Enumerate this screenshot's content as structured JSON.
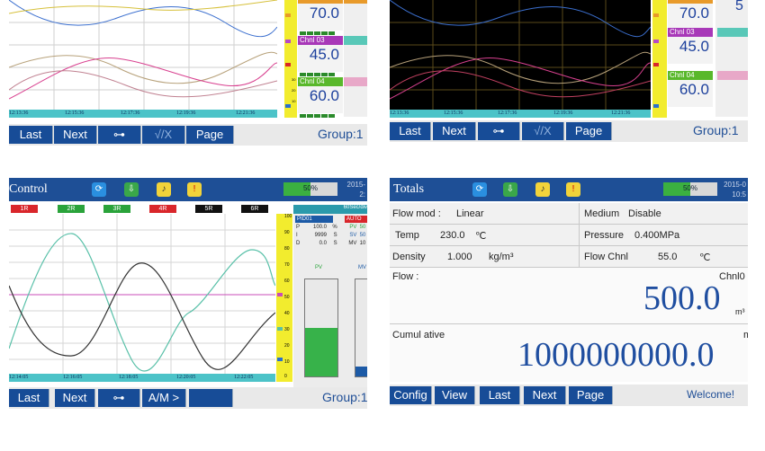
{
  "panel1": {
    "times": [
      "12:13:36",
      "12:15:36",
      "12:17:36",
      "12:19:36",
      "12:21:36"
    ],
    "channels": [
      {
        "name": "",
        "value": "70.0",
        "unit": "%"
      },
      {
        "name": "Chnl 03",
        "value": "45.0",
        "unit": "%"
      },
      {
        "name": "Chnl 04",
        "value": "60.0",
        "unit": "%"
      }
    ],
    "scale_labels": [
      "30",
      "20",
      "10"
    ],
    "buttons": [
      "Last",
      "Next",
      "",
      "√/X",
      "Page"
    ],
    "group": "Group:1"
  },
  "panel2": {
    "times": [
      "12:13:36",
      "12:15:36",
      "12:17:36",
      "12:19:36",
      "12:21:36"
    ],
    "channels": [
      {
        "name": "",
        "value": "70.0",
        "unit": "%"
      },
      {
        "name": "Chnl 03",
        "value": "45.0",
        "unit": "%"
      },
      {
        "name": "Chnl 04",
        "value": "60.0",
        "unit": "%"
      }
    ],
    "edge_value": "5",
    "buttons": [
      "Last",
      "Next",
      "",
      "√/X",
      "Page"
    ],
    "group": "Group:1"
  },
  "panel3": {
    "title": "Control",
    "progress_label": "50%",
    "progress": 0.5,
    "date": "2015-",
    "time": "2:",
    "channel_tabs": [
      "1R",
      "2R",
      "3R",
      "4R",
      "5R",
      "6R"
    ],
    "tab_colors": [
      "#d9262b",
      "#2aa33a",
      "#2aa33a",
      "#d9262b",
      "#111111",
      "#111111"
    ],
    "scale_labels": [
      "100",
      "90",
      "80",
      "70",
      "60",
      "50",
      "40",
      "30",
      "20",
      "10",
      "0"
    ],
    "times": [
      "12:14:05",
      "12:16:05",
      "12:18:05",
      "12:20:05",
      "12:22:05"
    ],
    "pid": {
      "rate": "60Sec/div",
      "name": "PID01",
      "mode": "AUTO",
      "rows": [
        {
          "k": "P",
          "v": "100.0",
          "u": "%",
          "k2": "PV",
          "v2": "50"
        },
        {
          "k": "I",
          "v": "9999",
          "u": "S",
          "k2": "SV",
          "v2": "50"
        },
        {
          "k": "D",
          "v": "0.0",
          "u": "S",
          "k2": "MV",
          "v2": "10"
        }
      ],
      "pv_label": "PV",
      "mv_label": "MV",
      "pv_level": 0.5
    },
    "buttons": [
      "Last",
      "Next",
      "",
      "A/M >",
      ""
    ],
    "group": "Group:1"
  },
  "panel4": {
    "title": "Totals",
    "progress_label": "50%",
    "progress": 0.5,
    "date": "2015-0",
    "time": "10:5",
    "rows": [
      {
        "l1": "Flow  mod :",
        "v1": "Linear",
        "l2": "Medium",
        "v2": "Disable"
      },
      {
        "l1": "Temp",
        "v1": "230.0",
        "u1": "℃",
        "l2": "Pressure",
        "v2": "0.400MPa"
      },
      {
        "l1": "Density",
        "v1": "1.000",
        "u1": "kg/m³",
        "l2": "Flow  Chnl",
        "v2": "55.0",
        "u2": "℃"
      }
    ],
    "flow_label": "Flow :",
    "flow_chnl": "Chnl0",
    "flow_value": "500.0",
    "flow_unit": "m³",
    "cumul_label": "Cumul  ative",
    "cumul_value": "1000000000.0",
    "cumul_unit": "m",
    "buttons": [
      "Config",
      "View",
      "Last",
      "Next",
      "Page"
    ],
    "welcome": "Welcome!"
  }
}
